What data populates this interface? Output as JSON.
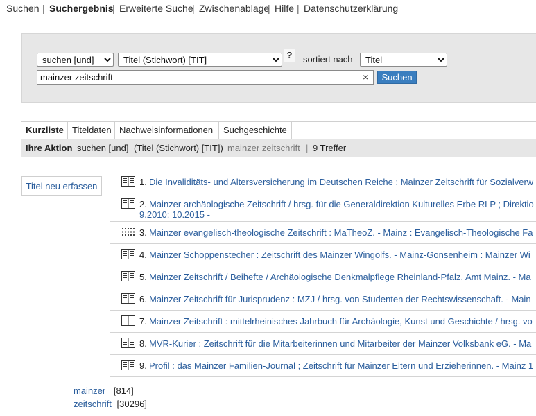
{
  "nav": {
    "items": [
      "Suchen",
      "Suchergebnis",
      "Erweiterte Suche",
      "Zwischenablage",
      "Hilfe",
      "Datenschutzerklärung"
    ],
    "separator": "|"
  },
  "search": {
    "operator": "suchen [und]",
    "field": "Titel (Stichwort) [TIT]",
    "help_label": "?",
    "sort_label": "sortiert nach",
    "sort_value": "Titel",
    "query": "mainzer zeitschrift",
    "clear_label": "×",
    "button_label": "Suchen"
  },
  "tabs": [
    "Kurzliste",
    "Titeldaten",
    "Nachweisinformationen",
    "Suchgeschichte"
  ],
  "action": {
    "label": "Ihre Aktion",
    "operator": "suchen [und]",
    "field": "(Titel (Stichwort) [TIT])",
    "query": "mainzer zeitschrift",
    "separator": "|",
    "hits": "9 Treffer"
  },
  "new_title_link": "Titel neu erfassen",
  "results": [
    {
      "num": "1.",
      "title": "Die Invaliditäts- und Altersversicherung im Deutschen Reiche : Mainzer Zeitschrift für Sozialverw",
      "line2": "",
      "icon": "book-icon"
    },
    {
      "num": "2.",
      "title": "Mainzer archäologische Zeitschrift / hrsg. für die Generaldirektion Kulturelles Erbe RLP ; Direktio",
      "line2": "9.2010; 10.2015 -",
      "icon": "book-icon"
    },
    {
      "num": "3.",
      "title": "Mainzer evangelisch-theologische Zeitschrift : MaTheoZ. - Mainz : Evangelisch-Theologische Fa",
      "line2": "",
      "icon": "online-icon"
    },
    {
      "num": "4.",
      "title": "Mainzer Schoppenstecher : Zeitschrift des Mainzer Wingolfs. - Mainz-Gonsenheim : Mainzer Wi",
      "line2": "",
      "icon": "book-icon"
    },
    {
      "num": "5.",
      "title": "Mainzer Zeitschrift / Beihefte / Archäologische Denkmalpflege Rheinland-Pfalz, Amt Mainz. - Ma",
      "line2": "",
      "icon": "book-icon"
    },
    {
      "num": "6.",
      "title": "Mainzer Zeitschrift für Jurisprudenz : MZJ / hrsg. von Studenten der Rechtswissenschaft. - Main",
      "line2": "",
      "icon": "book-icon"
    },
    {
      "num": "7.",
      "title": "Mainzer Zeitschrift : mittelrheinisches Jahrbuch für Archäologie, Kunst und Geschichte / hrsg. vo",
      "line2": "",
      "icon": "book-icon"
    },
    {
      "num": "8.",
      "title": "MVR-Kurier : Zeitschrift für die Mitarbeiterinnen und Mitarbeiter der Mainzer Volksbank eG. - Ma",
      "line2": "",
      "icon": "book-icon"
    },
    {
      "num": "9.",
      "title": "Profil : das Mainzer Familien-Journal ; Zeitschrift für Mainzer Eltern und Erzieherinnen. - Mainz 1",
      "line2": "",
      "icon": "book-icon"
    }
  ],
  "word_counts": [
    {
      "word": "mainzer",
      "count": "[814]"
    },
    {
      "word": "zeitschrift",
      "count": "[30296]"
    }
  ]
}
